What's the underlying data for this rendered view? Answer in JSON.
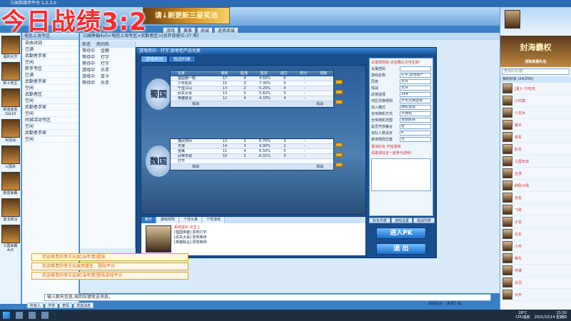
{
  "window": {
    "title": "三国英雄传平台 1.2.3.0"
  },
  "overlay": {
    "title": "今日战绩3:2"
  },
  "banner": {
    "text": "请↓刷更新三星奖池"
  },
  "top_buttons": [
    "游戏",
    "赛事",
    "商城",
    "道具商城"
  ],
  "left_games": [
    {
      "label": "福利大厅"
    },
    {
      "label": "新斗地主"
    },
    {
      "label": "新连连看10x10"
    },
    {
      "label": "军团战"
    },
    {
      "label": "三国杀"
    },
    {
      "label": "新雷争霸"
    },
    {
      "label": "金戈铁马"
    },
    {
      "label": "三国争霸4v5"
    }
  ],
  "tree": {
    "header": "电信上海专区",
    "rows": [
      "自由对战",
      "已满",
      "武勤者手家",
      "空闲",
      "新手专区",
      "已满",
      "武勤者手家",
      "空闲",
      "武勤者区",
      "空闲",
      "武勤者手家",
      "空闲",
      "同城活动专区",
      "空闲",
      "武勤者手家",
      "空闲"
    ]
  },
  "lobby": {
    "path": "三国争霸4v5>电信上海专区>武勤者区>[总开放座位:37 席]",
    "tables_header": [
      "状态",
      "房间名"
    ],
    "tables": [
      [
        "等待中",
        "金额"
      ],
      [
        "等待中",
        "打字"
      ],
      [
        "等待中",
        "打字"
      ],
      [
        "游戏中",
        "乐手"
      ],
      [
        "游戏中",
        "百卡"
      ],
      [
        "等待中",
        "乐手"
      ]
    ]
  },
  "room": {
    "title": "游戏房间 - 打字,原地老产品兑换",
    "tabs": [
      "游戏房间",
      "观战列表"
    ],
    "columns": [
      "玩家",
      "等级",
      "胜场",
      "胜率",
      "战力",
      "积分",
      "逃跑"
    ],
    "shu": {
      "label": "蜀国",
      "players": [
        [
          "蜀国第一枪",
          "17",
          "4",
          "4.50%",
          "6",
          "-"
        ],
        [
          "少年赵云",
          "15",
          "3",
          "7.30%",
          "0",
          "-"
        ],
        [
          "千里江山",
          "13",
          "2",
          "5.25%",
          "4",
          "-"
        ],
        [
          "武关大哥",
          "13",
          "3",
          "5.82%",
          "5",
          "-"
        ],
        [
          "英雄联合",
          "12",
          "4",
          "4.33%",
          "4",
          "-"
        ]
      ],
      "foot": [
        "观战",
        "观战"
      ]
    },
    "wei": {
      "label": "魏国",
      "players": [
        [
          "魏武骑兵",
          "13",
          "2",
          "6.70%",
          "3",
          "-"
        ],
        [
          "天狼",
          "14",
          "3",
          "4.90%",
          "2",
          "-"
        ],
        [
          "金鹰",
          "11",
          "4",
          "6.50%",
          "0",
          "-"
        ],
        [
          "武帝无敌",
          "10",
          "2",
          "6.31%",
          "0",
          "-"
        ],
        [
          "打开",
          "",
          "",
          "",
          "",
          ""
        ]
      ],
      "foot": [
        "观战",
        "观战"
      ]
    },
    "settings": {
      "header": "设置规则处:点击确认方可生效!",
      "rows": [
        [
          "设置密码",
          ""
        ],
        [
          "游戏名称",
          "打字,原地老产"
        ],
        [
          "同意",
          "允许"
        ],
        [
          "观战",
          "允许"
        ],
        [
          "武将选择",
          "3X4"
        ],
        [
          "何区交换规则",
          "不可交换选将"
        ],
        [
          "加入模式",
          "随机合成"
        ],
        [
          "全体随机方式",
          "不随机"
        ],
        [
          "全体随机范围",
          "全部武将"
        ],
        [
          "是否开放餐台",
          "否"
        ],
        [
          "双队人数设定",
          "4"
        ],
        [
          "禁将规则方案",
          "无"
        ]
      ],
      "note": "邀请好友 开始游戏",
      "note2": "请邀请好友一起参与游戏!"
    },
    "chat_tabs": [
      "聊天",
      "游戏规则",
      "个性头像",
      "个性游戏"
    ],
    "chat_lines": [
      {
        "text": "系统提示:点击上"
      },
      {
        "text": "[蜀国英雄] 原地打字"
      },
      {
        "text": "[武关大哥] 原地等待"
      },
      {
        "text": "[英雄联合] 原地等待"
      }
    ],
    "portrait_caption": [
      "头像设置",
      "刷新"
    ],
    "bottom_tabs": [
      "好友列表",
      "游戏设置",
      "观战列表"
    ],
    "enter_label": "进入PK",
    "exit_label": "退 出"
  },
  "notices": [
    "欢迎尊贵的帝王玩家[当年情]登陆",
    "欢迎尊贵的帝王玩家西楼生、登陆平台",
    "欢迎尊贵的帝王玩家[当年情]登陆游戏平台"
  ],
  "chat_input": {
    "placeholder": "输入聊天信息,按回车键发送消息。"
  },
  "send_row": [
    "所有人",
    "字体",
    "表情",
    "发送消息"
  ],
  "status": [
    "游戏提示",
    "系统广播"
  ],
  "right": {
    "ad_title": "封海霸权",
    "ad_sub": "领取新服礼包",
    "search_placeholder": "查找好友/群",
    "friends_header": "我的好友 (24/256)",
    "friends": [
      "[夏]一只吃鸡",
      "小红旗",
      "小龙女",
      "夏日",
      "将军",
      "卧龙",
      "三国无双",
      "五虎",
      "醉卧沙场",
      "无名",
      "飞将",
      "子龙",
      "云长",
      "小乔",
      "奉先",
      "仲谋",
      "关羽",
      "大乔"
    ]
  },
  "taskbar": {
    "weather": "28°C",
    "weather_label": "CPU温度",
    "time": "21:50",
    "date": "2021/10/14 星期四"
  },
  "lock_text": [
    "您的帐号有风险",
    "请立即修改密码"
  ]
}
